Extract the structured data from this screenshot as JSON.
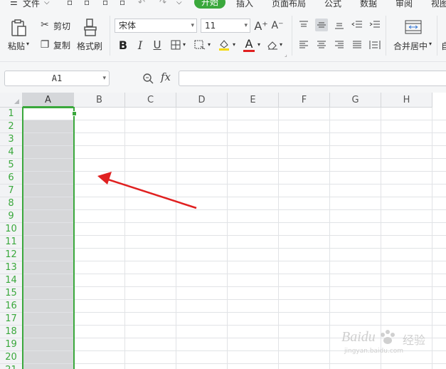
{
  "menubar": {
    "menu_icon": "hamburger-icon",
    "file_label": "文件",
    "tabs": [
      "开始",
      "插入",
      "页面布局",
      "公式",
      "数据",
      "审阅",
      "视图"
    ]
  },
  "ribbon": {
    "paste_label": "粘贴",
    "cut_label": "剪切",
    "copy_label": "复制",
    "format_painter_label": "格式刷",
    "font_name": "宋体",
    "font_size": "11",
    "bold": "B",
    "italic": "I",
    "underline": "U",
    "grow_font": "A⁺",
    "shrink_font": "A⁻",
    "font_color_glyph": "A",
    "merge_center_label": "合并居中",
    "auto_wrap_label": "自",
    "colors": {
      "accent": "#3aa83c",
      "font_color": "#e02020",
      "highlight": "#f5d800",
      "arrow": "#e02020"
    }
  },
  "formula_bar": {
    "cell_ref": "A1",
    "fx_label": "fx",
    "zoom_icon": "search-icon",
    "value": ""
  },
  "sheet": {
    "columns": [
      "A",
      "B",
      "C",
      "D",
      "E",
      "F",
      "G",
      "H"
    ],
    "rows": [
      "1",
      "2",
      "3",
      "4",
      "5",
      "6",
      "7",
      "8",
      "9",
      "10",
      "11",
      "12",
      "13",
      "14",
      "15",
      "16",
      "17",
      "18",
      "19",
      "20",
      "21"
    ],
    "selected_column": "A",
    "active_cell": "A1"
  },
  "watermark": {
    "brand": "Baidu",
    "sub": "经验",
    "url": "jingyan.baidu.com"
  }
}
